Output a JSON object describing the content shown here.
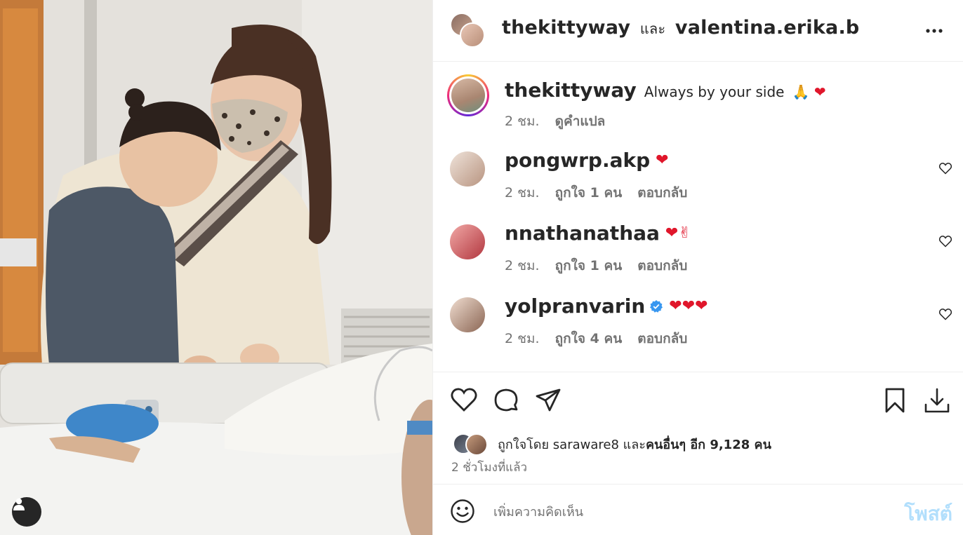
{
  "post": {
    "authors": {
      "primary": "thekittyway",
      "conjunction": "และ",
      "secondary": "valentina.erika.b"
    },
    "caption": {
      "username": "thekittyway",
      "text": "Always by your side",
      "emoji": "🙏 ❤",
      "time": "2 ชม.",
      "translate": "ดูคำแปล"
    },
    "comments": [
      {
        "username": "pongwrp.akp",
        "text": "❤",
        "time": "2 ชม.",
        "likes": "ถูกใจ 1 คน",
        "reply": "ตอบกลับ",
        "verified": false,
        "avatar_color": "#d9c6b8"
      },
      {
        "username": "nnathanathaa",
        "text": "❤✌",
        "time": "2 ชม.",
        "likes": "ถูกใจ 1 คน",
        "reply": "ตอบกลับ",
        "verified": false,
        "avatar_color": "#e78a8f"
      },
      {
        "username": "yolpranvarin",
        "text": "❤❤❤",
        "time": "2 ชม.",
        "likes": "ถูกใจ 4 คน",
        "reply": "ตอบกลับ",
        "verified": true,
        "avatar_color": "#c9a58e"
      }
    ],
    "likes": {
      "prefix": "ถูกใจโดย",
      "first_liker": "saraware8",
      "joiner": "และ",
      "others_label": "คนอื่นๆ อีก 9,128 คน"
    },
    "timestamp": "2 ชั่วโมงที่แล้ว"
  },
  "composer": {
    "placeholder": "เพิ่มความคิดเห็น",
    "post_label": "โพสต์"
  },
  "icons": {
    "more": "more-horizontal-icon",
    "like": "heart-icon",
    "comment": "comment-icon",
    "share": "send-icon",
    "save": "bookmark-icon",
    "download": "download-icon",
    "emoji": "smile-icon",
    "tag": "user-tag-icon"
  },
  "colors": {
    "accent": "#0095f6",
    "post_disabled": "#b2dffc",
    "heart_red": "#e0162b",
    "verified_blue": "#3897f0"
  }
}
